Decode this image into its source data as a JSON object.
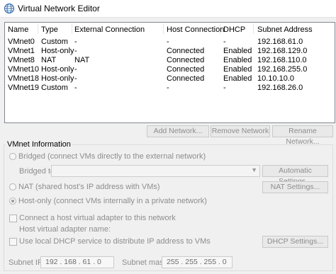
{
  "window": {
    "title": "Virtual Network Editor",
    "icon": "globe-icon"
  },
  "table": {
    "headers": [
      "Name",
      "Type",
      "External Connection",
      "Host Connection",
      "DHCP",
      "Subnet Address"
    ],
    "rows": [
      [
        "VMnet0",
        "Custom",
        "-",
        "-",
        "-",
        "192.168.61.0"
      ],
      [
        "VMnet1",
        "Host-only",
        "-",
        "Connected",
        "Enabled",
        "192.168.129.0"
      ],
      [
        "VMnet8",
        "NAT",
        "NAT",
        "Connected",
        "Enabled",
        "192.168.110.0"
      ],
      [
        "VMnet10",
        "Host-only",
        "-",
        "Connected",
        "Enabled",
        "192.168.255.0"
      ],
      [
        "VMnet18",
        "Host-only",
        "-",
        "Connected",
        "Enabled",
        "10.10.10.0"
      ],
      [
        "VMnet19",
        "Custom",
        "-",
        "-",
        "-",
        "192.168.26.0"
      ]
    ]
  },
  "buttons": {
    "add": "Add Network...",
    "remove": "Remove Network",
    "rename": "Rename Network..."
  },
  "vmnet_info": {
    "label": "VMnet Information",
    "bridged_label": "Bridged (connect VMs directly to the external network)",
    "bridged_to_label": "Bridged to:",
    "bridged_to_value": "",
    "automatic_settings": "Automatic Settings...",
    "nat_label": "NAT (shared host's IP address with VMs)",
    "nat_settings": "NAT Settings...",
    "hostonly_label": "Host-only (connect VMs internally in a private network)",
    "connect_adapter_label": "Connect a host virtual adapter to this network",
    "adapter_name_label": "Host virtual adapter name:",
    "dhcp_label": "Use local DHCP service to distribute IP address to VMs",
    "dhcp_settings": "DHCP Settings...",
    "subnet_ip_label": "Subnet IP:",
    "subnet_ip": "192 . 168 . 61 . 0",
    "subnet_mask_label": "Subnet mask:",
    "subnet_mask": "255 . 255 . 255 . 0"
  }
}
